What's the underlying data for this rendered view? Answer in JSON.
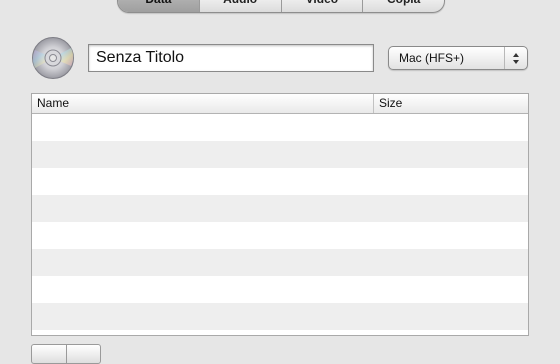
{
  "tabs": [
    {
      "label": "Data",
      "selected": true
    },
    {
      "label": "Audio",
      "selected": false
    },
    {
      "label": "Video",
      "selected": false
    },
    {
      "label": "Copia",
      "selected": false
    }
  ],
  "disc_icon": "cd-disc-icon",
  "title_field": {
    "value": "Senza Titolo"
  },
  "format_select": {
    "selected": "Mac (HFS+)"
  },
  "table": {
    "columns": [
      "Name",
      "Size"
    ],
    "row_count": 8
  },
  "bottom_buttons": [
    "add-button",
    "remove-button"
  ],
  "colors": {
    "window_bg": "#e6e6e6",
    "row_alt": "#eeeeee",
    "border": "#a9a9a9"
  }
}
